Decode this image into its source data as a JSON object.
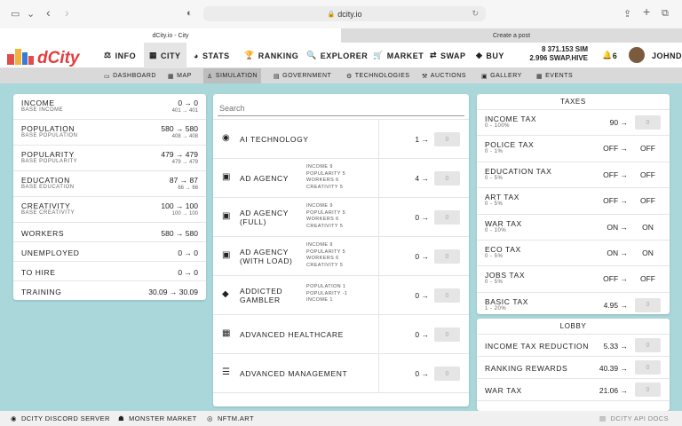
{
  "browser": {
    "url": "dcity.io",
    "tab_active": "dCity.io - City",
    "tab_other": "Create a post"
  },
  "nav": {
    "items": [
      "INFO",
      "CITY",
      "STATS",
      "RANKING",
      "EXPLORER",
      "MARKET",
      "SWAP",
      "BUY"
    ],
    "sim": "8 371.153 SIM",
    "swap": "2.996 SWAP.HIVE",
    "bell": "6",
    "user": "JOHNDI"
  },
  "subnav": [
    "DASHBOARD",
    "MAP",
    "SIMULATION",
    "GOVERNMENT",
    "TECHNOLOGIES",
    "AUCTIONS",
    "GALLERY",
    "EVENTS"
  ],
  "stats": [
    {
      "label": "INCOME",
      "sub": "BASE INCOME",
      "val": "0 → 0",
      "subval": "401 → 401"
    },
    {
      "label": "POPULATION",
      "sub": "BASE POPULATION",
      "val": "580 → 580",
      "subval": "408 → 408"
    },
    {
      "label": "POPULARITY",
      "sub": "BASE POPULARITY",
      "val": "479 → 479",
      "subval": "479 → 479"
    },
    {
      "label": "EDUCATION",
      "sub": "BASE EDUCATION",
      "val": "87 → 87",
      "subval": "66 → 66"
    },
    {
      "label": "CREATIVITY",
      "sub": "BASE CREATIVITY",
      "val": "100 → 100",
      "subval": "100 → 100"
    },
    {
      "label": "WORKERS",
      "sub": "",
      "val": "580 → 580",
      "subval": ""
    },
    {
      "label": "UNEMPLOYED",
      "sub": "",
      "val": "0 → 0",
      "subval": ""
    },
    {
      "label": "TO HIRE",
      "sub": "",
      "val": "0 → 0",
      "subval": ""
    },
    {
      "label": "TRAINING",
      "sub": "",
      "val": "30.09 → 30.09",
      "subval": ""
    }
  ],
  "search": {
    "placeholder": "Search"
  },
  "techs": [
    {
      "name": "AI TECHNOLOGY",
      "name2": "",
      "stats": [],
      "count": "1 →",
      "box": "0"
    },
    {
      "name": "AD AGENCY",
      "name2": "",
      "stats": [
        "INCOME 9",
        "POPULARITY 5",
        "WORKERS 6",
        "CREATIVITY 5"
      ],
      "count": "4 →",
      "box": "0"
    },
    {
      "name": "AD AGENCY",
      "name2": "(FULL)",
      "stats": [
        "INCOME 9",
        "POPULARITY 5",
        "WORKERS 6",
        "CREATIVITY 5"
      ],
      "count": "0 →",
      "box": "0"
    },
    {
      "name": "AD AGENCY",
      "name2": "(WITH LOAD)",
      "stats": [
        "INCOME 9",
        "POPULARITY 5",
        "WORKERS 6",
        "CREATIVITY 5"
      ],
      "count": "0 →",
      "box": "0"
    },
    {
      "name": "ADDICTED",
      "name2": "GAMBLER",
      "stats": [
        "POPULATION 1",
        "POPULARITY -1",
        "INCOME 1"
      ],
      "count": "0 →",
      "box": "0"
    },
    {
      "name": "ADVANCED HEALTHCARE",
      "name2": "",
      "stats": [],
      "count": "0 →",
      "box": "0"
    },
    {
      "name": "ADVANCED MANAGEMENT",
      "name2": "",
      "stats": [],
      "count": "0 →",
      "box": "0"
    }
  ],
  "taxes": {
    "title": "TAXES",
    "items": [
      {
        "label": "INCOME TAX",
        "range": "0 - 100%",
        "val": "90 →",
        "box": "0"
      },
      {
        "label": "POLICE TAX",
        "range": "0 - 1%",
        "val": "OFF →",
        "box": "OFF"
      },
      {
        "label": "EDUCATION TAX",
        "range": "0 - 5%",
        "val": "OFF →",
        "box": "OFF"
      },
      {
        "label": "ART TAX",
        "range": "0 - 5%",
        "val": "OFF →",
        "box": "OFF"
      },
      {
        "label": "WAR TAX",
        "range": "0 - 10%",
        "val": "ON →",
        "box": "ON"
      },
      {
        "label": "ECO TAX",
        "range": "0 - 5%",
        "val": "ON →",
        "box": "ON"
      },
      {
        "label": "JOBS TAX",
        "range": "0 - 5%",
        "val": "OFF →",
        "box": "OFF"
      },
      {
        "label": "BASIC TAX",
        "range": "1 - 20%",
        "val": "4.95 →",
        "box": "0"
      }
    ]
  },
  "lobby": {
    "title": "LOBBY",
    "items": [
      {
        "label": "INCOME TAX REDUCTION",
        "val": "5.33 →",
        "box": "0"
      },
      {
        "label": "RANKING REWARDS",
        "val": "40.39 →",
        "box": "0"
      },
      {
        "label": "WAR TAX",
        "val": "21.06 →",
        "box": "0"
      }
    ]
  },
  "footer": {
    "discord": "DCITY DISCORD SERVER",
    "monster": "MONSTER MARKET",
    "nftm": "NFTM.ART",
    "api": "DCITY API DOCS"
  }
}
